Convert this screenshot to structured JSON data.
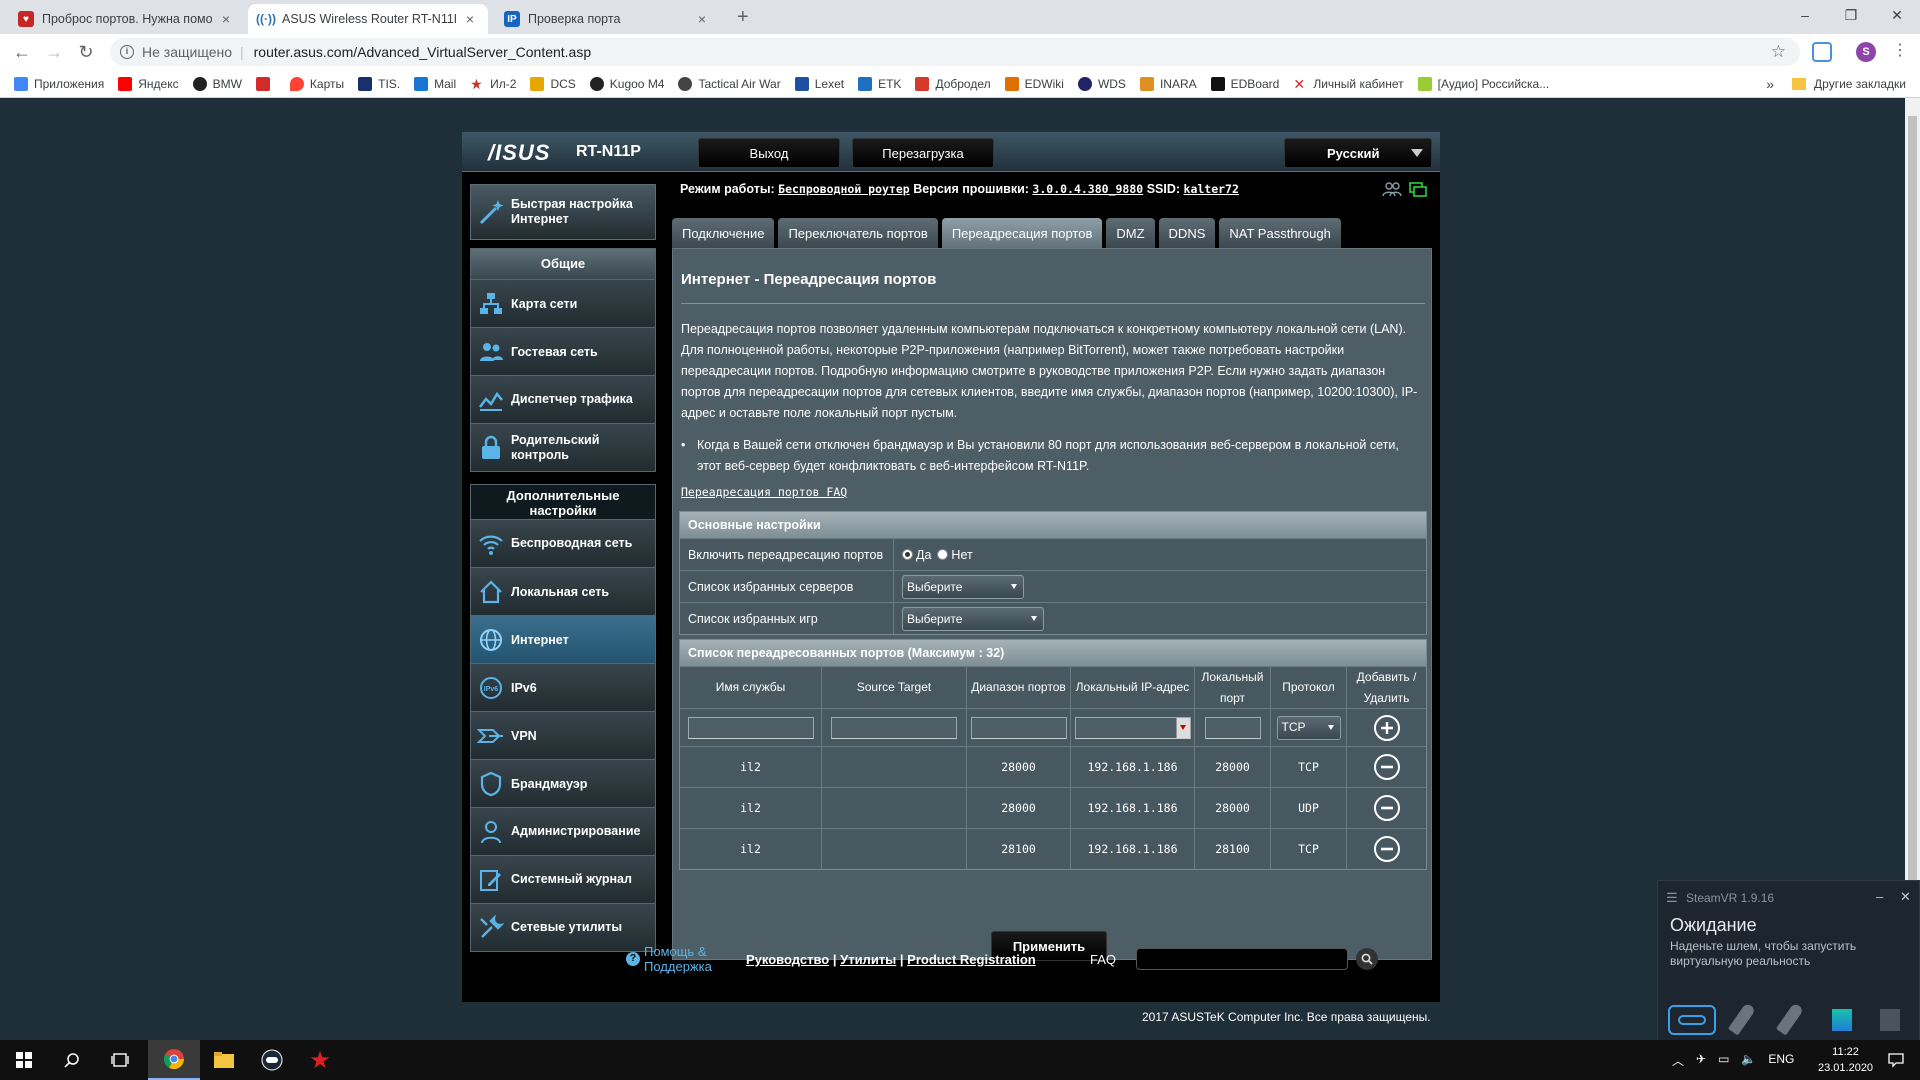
{
  "browser": {
    "tabs": [
      {
        "title": "Проброс портов. Нужна помощ",
        "close": "×"
      },
      {
        "title": "ASUS Wireless Router RT-N11P -",
        "close": "×"
      },
      {
        "title": "Проверка порта",
        "close": "×",
        "favicon": "IP"
      }
    ],
    "new_tab": "+",
    "window": {
      "minimize": "–",
      "restore": "❐",
      "close": "✕"
    },
    "nav": {
      "back": "←",
      "forward": "→",
      "reload": "↻"
    },
    "address": {
      "security": "Не защищено",
      "separator": "|",
      "url": "router.asus.com/Advanced_VirtualServer_Content.asp",
      "star": "☆"
    },
    "profile": "S",
    "bookmarks": [
      {
        "label": "Приложения",
        "color": "#4285f4"
      },
      {
        "label": "Яндекс",
        "color": "#ff0000"
      },
      {
        "label": "BMW",
        "color": "#222222"
      },
      {
        "label": "",
        "color": "#d22b2b"
      },
      {
        "label": "Карты",
        "color": "#ff4433"
      },
      {
        "label": "TIS.",
        "color": "#1a2f6e"
      },
      {
        "label": "Mail",
        "color": "#1976d2"
      },
      {
        "label": "Ил-2",
        "color": "#c0392b"
      },
      {
        "label": "DCS",
        "color": "#e6a800"
      },
      {
        "label": "Kugoo M4",
        "color": "#222222"
      },
      {
        "label": "Tactical Air War",
        "color": "#444444"
      },
      {
        "label": "Lexet",
        "color": "#1f4fa0"
      },
      {
        "label": "ETK",
        "color": "#1e6fbf"
      },
      {
        "label": "Добродел",
        "color": "#d63a2a"
      },
      {
        "label": "EDWiki",
        "color": "#e07000"
      },
      {
        "label": "WDS",
        "color": "#222266"
      },
      {
        "label": "INARA",
        "color": "#e09020"
      },
      {
        "label": "EDBoard",
        "color": "#111111"
      },
      {
        "label": "Личный кабинет",
        "color": "#d42b2b"
      },
      {
        "label": "[Аудио] Российска...",
        "color": "#9c3"
      }
    ],
    "bookmarks_more": "»",
    "other_bookmarks": "Другие закладки"
  },
  "router": {
    "logo": "/ISUS",
    "model": "RT-N11P",
    "logout": "Выход",
    "reboot": "Перезагрузка",
    "language": "Русский",
    "status": {
      "mode_label": "Режим работы:",
      "mode": "Беспроводной роутер",
      "fw_label": "Версия прошивки:",
      "fw": "3.0.0.4.380_9880",
      "ssid_label": "SSID:",
      "ssid": "kalter72"
    },
    "sidebar": {
      "quick": "Быстрая настройка Интернет",
      "general_title": "Общие",
      "general": [
        "Карта сети",
        "Гостевая сеть",
        "Диспетчер трафика",
        "Родительский контроль"
      ],
      "advanced_title": "Дополнительные настройки",
      "advanced": [
        "Беспроводная сеть",
        "Локальная сеть",
        "Интернет",
        "IPv6",
        "VPN",
        "Брандмауэр",
        "Админист­рирование",
        "Системный журнал",
        "Сетевые утилиты"
      ]
    },
    "tabs": [
      "Подключение",
      "Переключатель портов",
      "Переадресация портов",
      "DMZ",
      "DDNS",
      "NAT Passthrough"
    ],
    "title": "Интернет - Переадресация портов",
    "description": "Переадресация портов позволяет удаленным компьютерам подключаться к конкретному компьютеру локальной сети (LAN). Для полноценной работы, некоторые P2P-приложения (например BitTorrent), может также потребовать настройки переадресации портов. Подробную информацию смотрите в руководстве приложения P2P. Если нужно задать диапазон портов для переадресации портов для сетевых клиентов, введите имя службы, диапазон портов (например, 10200:10300), IP-адрес и оставьте поле локальный порт пустым.",
    "bullet": "Когда в Вашей сети отключен брандмауэр и Вы установили 80 порт для использования веб-сервером в локальной сети, этот веб-сервер будет конфликтовать с веб-интерфейсом RT-N11P.",
    "faq_link": "Переадресация портов FAQ",
    "basic": {
      "header": "Основные настройки",
      "enable_label": "Включить переадресацию портов",
      "yes": "Да",
      "no": "Нет",
      "servers_label": "Список избранных серверов",
      "servers_value": "Выберите",
      "games_label": "Список избранных игр",
      "games_value": "Выберите"
    },
    "list": {
      "header": "Список переадресованных портов (Максимум : 32)",
      "columns": [
        "Имя службы",
        "Source Target",
        "Диапазон портов",
        "Локальный IP-адрес",
        "Локальный порт",
        "Протокол",
        "Добавить / Удалить"
      ],
      "new_protocol": "TCP",
      "rows": [
        {
          "name": "il2",
          "source": "",
          "range": "28000",
          "ip": "192.168.1.186",
          "port": "28000",
          "proto": "TCP"
        },
        {
          "name": "il2",
          "source": "",
          "range": "28000",
          "ip": "192.168.1.186",
          "port": "28000",
          "proto": "UDP"
        },
        {
          "name": "il2",
          "source": "",
          "range": "28100",
          "ip": "192.168.1.186",
          "port": "28100",
          "proto": "TCP"
        }
      ]
    },
    "apply": "Применить",
    "footer": {
      "help": "Помощь & Поддержка",
      "manual": "Руководство",
      "utils": "Утилиты",
      "registration": "Product Registration",
      "sep": "|",
      "faq": "FAQ"
    },
    "copyright": "2017 ASUSTeK Computer Inc. Все права защищены."
  },
  "steamvr": {
    "title": "SteamVR 1.9.16",
    "status": "Ожидание",
    "message": "Наденьте шлем, чтобы запустить виртуальную реальность",
    "min": "–",
    "close": "✕"
  },
  "taskbar": {
    "lang": "ENG",
    "time": "11:22",
    "date": "23.01.2020"
  }
}
